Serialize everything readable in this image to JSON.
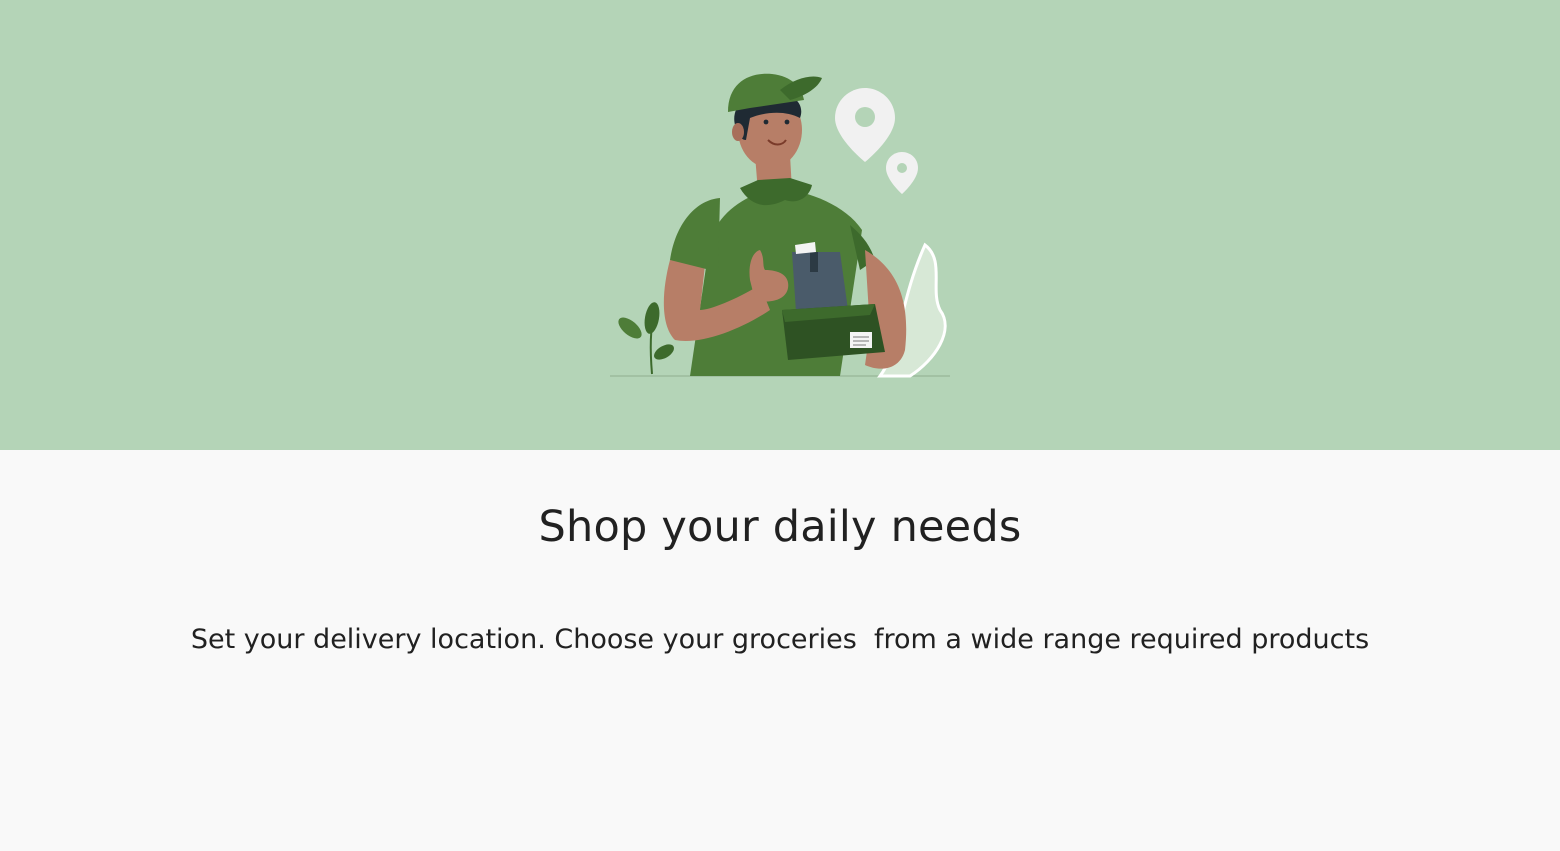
{
  "hero": {
    "illustration_icon": "delivery-man-illustration",
    "background_color": "#b4d4b7",
    "accent_color": "#4e7d38"
  },
  "onboarding": {
    "title": "Shop your daily needs",
    "description": "Set your delivery location. Choose your groceries  from a wide range required products"
  }
}
